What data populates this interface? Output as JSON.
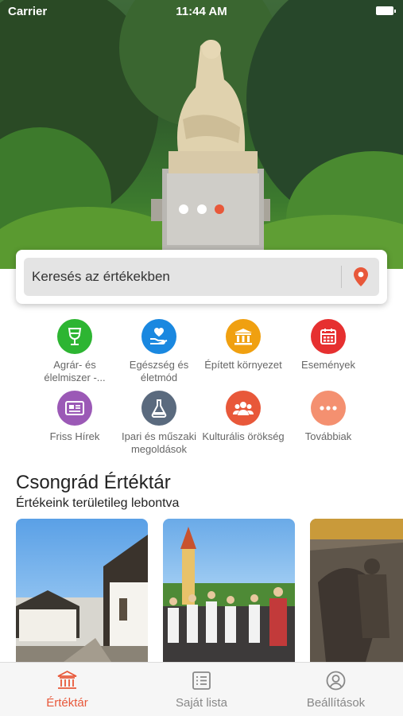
{
  "status_bar": {
    "carrier": "Carrier",
    "time": "11:44 AM"
  },
  "hero": {
    "slide_count": 3,
    "active_slide": 3
  },
  "search": {
    "placeholder": "Keresés az értékekben",
    "pin_icon": "location-pin-icon",
    "pin_color": "#e8583a"
  },
  "categories": [
    {
      "label": "Agrár- és élelmiszer -...",
      "icon": "wine-glass-icon",
      "color": "#2db532"
    },
    {
      "label": "Egészség és életmód",
      "icon": "heart-hand-icon",
      "color": "#1a88e0"
    },
    {
      "label": "Épített környezet",
      "icon": "building-icon",
      "color": "#f0a010"
    },
    {
      "label": "Események",
      "icon": "calendar-icon",
      "color": "#e63030"
    },
    {
      "label": "Friss Hírek",
      "icon": "newspaper-icon",
      "color": "#9b59b6"
    },
    {
      "label": "Ipari és műszaki megoldások",
      "icon": "flask-icon",
      "color": "#5a6a7e"
    },
    {
      "label": "Kulturális örökség",
      "icon": "people-icon",
      "color": "#e8583a"
    },
    {
      "label": "Továbbiak",
      "icon": "more-dots-icon",
      "color": "#f49070"
    }
  ],
  "section": {
    "title": "Csongrád Értéktár",
    "subtitle": "Értékeink területileg lebontva"
  },
  "tabbar": {
    "tabs": [
      {
        "label": "Értéktár",
        "icon": "museum-icon",
        "active": true
      },
      {
        "label": "Saját lista",
        "icon": "list-icon",
        "active": false
      },
      {
        "label": "Beállítások",
        "icon": "user-circle-icon",
        "active": false
      }
    ],
    "active_color": "#e8583a"
  }
}
